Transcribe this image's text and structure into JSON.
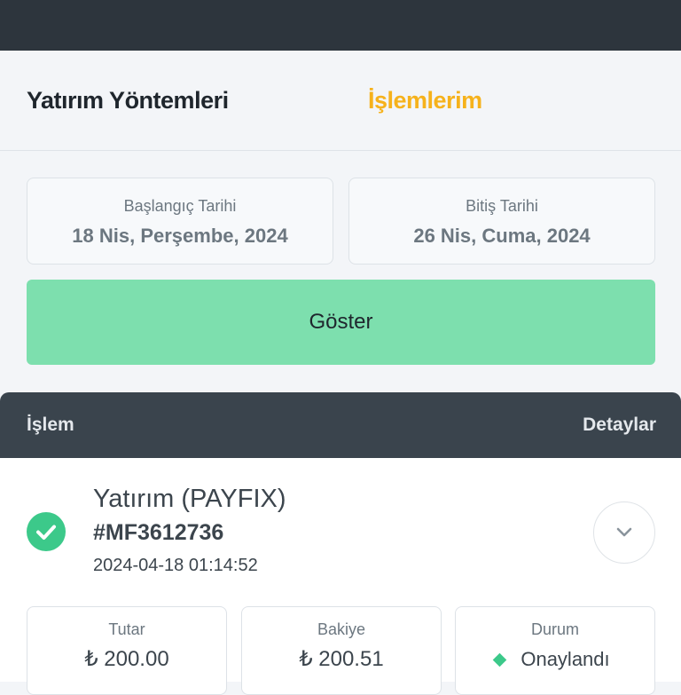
{
  "tabs": {
    "deposit_methods": "Yatırım Yöntemleri",
    "my_transactions": "İşlemlerim",
    "active_color": "#f6b21c"
  },
  "filter": {
    "start_label": "Başlangıç Tarihi",
    "start_value": "18 Nis, Perşembe, 2024",
    "end_label": "Bitiş Tarihi",
    "end_value": "26 Nis, Cuma, 2024",
    "show_button": "Göster",
    "button_color": "#7ddfae"
  },
  "list_header": {
    "left": "İşlem",
    "right": "Detaylar"
  },
  "transaction": {
    "title": "Yatırım (PAYFIX)",
    "id": "#MF3612736",
    "timestamp": "2024-04-18 01:14:52",
    "status_icon": "check-circle-icon",
    "expand_icon": "chevron-down-icon",
    "amount_label": "Tutar",
    "amount_value": "₺ 200.00",
    "balance_label": "Bakiye",
    "balance_value": "₺ 200.51",
    "status_label": "Durum",
    "status_value": "Onaylandı",
    "status_color": "#3cc98a"
  }
}
